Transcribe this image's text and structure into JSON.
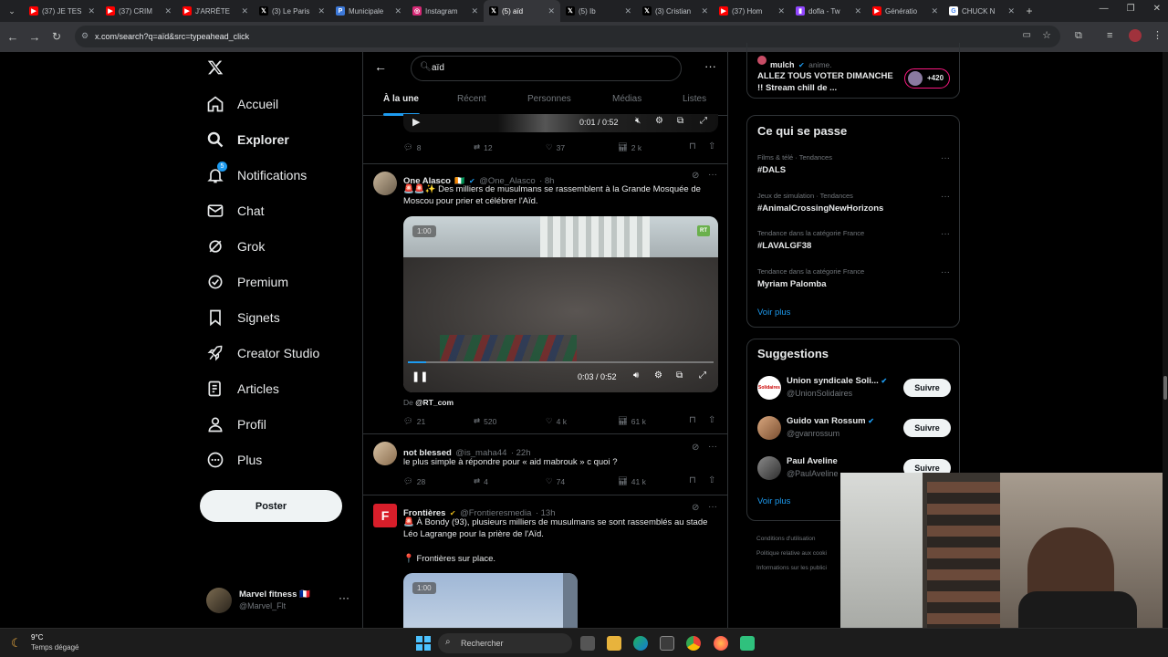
{
  "browser": {
    "tabs": [
      {
        "title": "(37) JE TES",
        "icon": "youtube-icon"
      },
      {
        "title": "(37) CRIM",
        "icon": "youtube-icon"
      },
      {
        "title": "J'ARRÊTE",
        "icon": "youtube-icon"
      },
      {
        "title": "(3) Le Paris",
        "icon": "x-icon"
      },
      {
        "title": "Municipale",
        "icon": "page-icon"
      },
      {
        "title": "Instagram",
        "icon": "instagram-icon"
      },
      {
        "title": "(5) aïd",
        "icon": "x-icon",
        "active": true
      },
      {
        "title": "(5) Ib",
        "icon": "x-icon"
      },
      {
        "title": "(3) Cristian",
        "icon": "x-icon"
      },
      {
        "title": "(37) Hom",
        "icon": "youtube-icon"
      },
      {
        "title": "dofla - Tw",
        "icon": "twitch-icon"
      },
      {
        "title": "Génératio",
        "icon": "youtube-icon"
      },
      {
        "title": "CHUCK N",
        "icon": "google-icon"
      }
    ],
    "url": "x.com/search?q=aïd&src=typeahead_click"
  },
  "nav": {
    "items": [
      "Accueil",
      "Explorer",
      "Notifications",
      "Chat",
      "Grok",
      "Premium",
      "Signets",
      "Creator Studio",
      "Articles",
      "Profil",
      "Plus"
    ],
    "notif_count": "5",
    "post_label": "Poster",
    "account_name": "Marvel fitness 🇫🇷",
    "account_handle": "@Marvel_Flt"
  },
  "search": {
    "query": "aïd",
    "tabs": [
      "À la une",
      "Récent",
      "Personnes",
      "Médias",
      "Listes"
    ]
  },
  "tweets": [
    {
      "video_time": "0:01 / 0:52",
      "replies": "8",
      "retweets": "12",
      "likes": "37",
      "views": "2 k"
    },
    {
      "name": "One Alasco",
      "handle": "@One_Alasco",
      "time": "· 8h",
      "text": "🚨🚨✨ Des milliers de musulmans se rassemblent à la Grande Mosquée de Moscou pour prier et célébrer l'Aïd.",
      "video_badge": "1:00",
      "video_time": "0:03 / 0:52",
      "source_prefix": "De ",
      "source": "@RT_com",
      "replies": "21",
      "retweets": "520",
      "likes": "4 k",
      "views": "61 k"
    },
    {
      "name": "not blessed",
      "handle": "@is_maha44",
      "time": "· 22h",
      "text": "le plus simple à répondre pour « aid mabrouk » c quoi ?",
      "replies": "28",
      "retweets": "4",
      "likes": "74",
      "views": "41 k"
    },
    {
      "name": "Frontières",
      "handle": "@Frontieresmedia",
      "time": "· 13h",
      "text": "🚨 À Bondy (93), plusieurs milliers de musulmans se sont rassemblés au stade Léo Lagrange pour la prière de l'Aïd.",
      "text2": "📍 Frontières sur place.",
      "video_badge": "1:00"
    }
  ],
  "right": {
    "top_user": "mulch",
    "top_user_tag": "anime.",
    "top_text": "ALLEZ TOUS VOTER DIMANCHE !! Stream chill de ...",
    "top_count": "+420",
    "trends_title": "Ce qui se passe",
    "trends": [
      {
        "category": "Films & télé · Tendances",
        "name": "#DALS"
      },
      {
        "category": "Jeux de simulation · Tendances",
        "name": "#AnimalCrossingNewHorizons"
      },
      {
        "category": "Tendance dans la catégorie France",
        "name": "#LAVALGF38"
      },
      {
        "category": "Tendance dans la catégorie France",
        "name": "Myriam Palomba"
      }
    ],
    "more": "Voir plus",
    "suggest_title": "Suggestions",
    "suggestions": [
      {
        "name": "Union syndicale Soli...",
        "handle": "@UnionSolidaires"
      },
      {
        "name": "Guido van Rossum",
        "handle": "@gvanrossum"
      },
      {
        "name": "Paul Aveline",
        "handle": "@PaulAveline"
      }
    ],
    "follow_label": "Suivre",
    "footer": [
      "Conditions d'utilisation",
      "Politique relative aux cooki",
      "Informations sur les publici"
    ]
  },
  "taskbar": {
    "temp": "9°C",
    "weather": "Temps dégagé",
    "search": "Rechercher"
  },
  "colors": {
    "accent": "#1d9bf0",
    "verified": "#1d9bf0",
    "gold": "#e2b719"
  }
}
